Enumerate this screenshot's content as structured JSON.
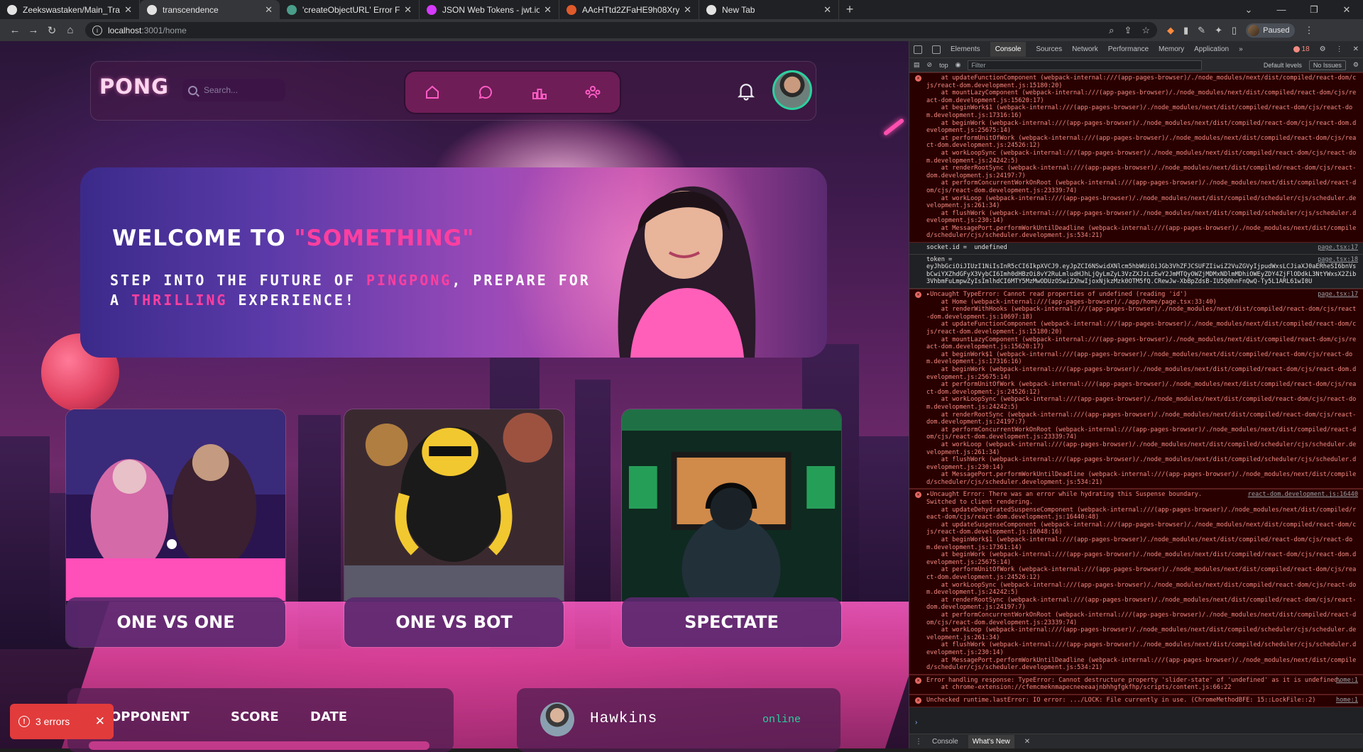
{
  "browser": {
    "tabs": [
      {
        "title": "Zeekswastaken/Main_Tra",
        "fav": "#e3e3e3",
        "active": false
      },
      {
        "title": "transcendence",
        "fav": "#e3e3e3",
        "active": true
      },
      {
        "title": "'createObjectURL' Error F",
        "fav": "#4a9d8a",
        "active": false
      },
      {
        "title": "JSON Web Tokens - jwt.io",
        "fav": "#d63aff",
        "active": false
      },
      {
        "title": "AAcHTtd2ZFaHE9h08Xry",
        "fav": "#e05a2b",
        "active": false
      },
      {
        "title": "New Tab",
        "fav": "#e3e3e3",
        "active": false
      }
    ],
    "url_host": "localhost",
    "url_path": ":3001/home",
    "profile_status": "Paused"
  },
  "page": {
    "logo": "PONG",
    "search_placeholder": "Search...",
    "hero": {
      "title_main": "WELCOME TO ",
      "title_highlight": "\"SOMETHING\"",
      "sub_a": "STEP INTO THE FUTURE OF ",
      "sub_hl1": "PINGPONG",
      "sub_b": ", PREPARE FOR A ",
      "sub_hl2": "THRILLING",
      "sub_c": " EXPERIENCE!"
    },
    "modes": [
      "ONE VS ONE",
      "ONE VS BOT",
      "SPECTATE"
    ],
    "history_cols": [
      "OPPONENT",
      "SCORE",
      "DATE"
    ],
    "friend": {
      "name": "Hawkins",
      "status": "online"
    },
    "error_toast": "3 errors"
  },
  "devtools": {
    "tabs": [
      "Elements",
      "Console",
      "Sources",
      "Network",
      "Performance",
      "Memory",
      "Application"
    ],
    "active_tab": "Console",
    "error_count": "18",
    "context": "top",
    "filter_placeholder": "Filter",
    "levels": "Default levels",
    "issues": "No Issues",
    "drawer_tabs": [
      "Console",
      "What's New"
    ],
    "messages": [
      {
        "type": "err",
        "src": "",
        "text": "    at updateFunctionComponent (webpack-internal:///(app-pages-browser)/./node_modules/next/dist/compiled/react-dom/cjs/react-dom.development.js:15180:20)\n    at mountLazyComponent (webpack-internal:///(app-pages-browser)/./node_modules/next/dist/compiled/react-dom/cjs/react-dom.development.js:15620:17)\n    at beginWork$1 (webpack-internal:///(app-pages-browser)/./node_modules/next/dist/compiled/react-dom/cjs/react-dom.development.js:17316:16)\n    at beginWork (webpack-internal:///(app-pages-browser)/./node_modules/next/dist/compiled/react-dom/cjs/react-dom.development.js:25675:14)\n    at performUnitOfWork (webpack-internal:///(app-pages-browser)/./node_modules/next/dist/compiled/react-dom/cjs/react-dom.development.js:24526:12)\n    at workLoopSync (webpack-internal:///(app-pages-browser)/./node_modules/next/dist/compiled/react-dom/cjs/react-dom.development.js:24242:5)\n    at renderRootSync (webpack-internal:///(app-pages-browser)/./node_modules/next/dist/compiled/react-dom/cjs/react-dom.development.js:24197:7)\n    at performConcurrentWorkOnRoot (webpack-internal:///(app-pages-browser)/./node_modules/next/dist/compiled/react-dom/cjs/react-dom.development.js:23339:74)\n    at workLoop (webpack-internal:///(app-pages-browser)/./node_modules/next/dist/compiled/scheduler/cjs/scheduler.development.js:261:34)\n    at flushWork (webpack-internal:///(app-pages-browser)/./node_modules/next/dist/compiled/scheduler/cjs/scheduler.development.js:230:14)\n    at MessagePort.performWorkUntilDeadline (webpack-internal:///(app-pages-browser)/./node_modules/next/dist/compiled/scheduler/cjs/scheduler.development.js:534:21)"
      },
      {
        "type": "log",
        "src": "page.tsx:17",
        "text": "socket.id =  undefined"
      },
      {
        "type": "log",
        "src": "page.tsx:18",
        "text": "token =\neyJhbGciOiJIUzI1NiIsInR5cCI6IkpXVCJ9.eyJpZCI6NSwidXNlcm5hbWUiOiJGb3VhZFJCSUFZIiwiZ2VuZGVyIjpudWxsLCJiaXJ0aERheSI6bnVsbCwiYXZhdGFyX3VybCI6Imh0dHBzOi8vY2RuLmludHJhLjQyLmZyL3VzZXJzLzEwY2JmMTQyOWZjMDMxNDlmMDhiOWEyZDY4ZjFlODdkL3NtYWxsX2Zib3VhbmFuLmpwZyIsImlhdCI6MTY5MzMwODUzOSwiZXhwIjoxNjkzMzk0OTM5fQ.CRewJw-XbBpZdsB-IU5Q0hnFnQwQ-Ty5L1ARL61wI0U"
      },
      {
        "type": "err",
        "src": "page.tsx:17",
        "text": "▸Uncaught TypeError: Cannot read properties of undefined (reading 'id')\n    at Home (webpack-internal:///(app-pages-browser)/./app/home/page.tsx:33:40)\n    at renderWithHooks (webpack-internal:///(app-pages-browser)/./node_modules/next/dist/compiled/react-dom/cjs/react-dom.development.js:10697:18)\n    at updateFunctionComponent (webpack-internal:///(app-pages-browser)/./node_modules/next/dist/compiled/react-dom/cjs/react-dom.development.js:15180:20)\n    at mountLazyComponent (webpack-internal:///(app-pages-browser)/./node_modules/next/dist/compiled/react-dom/cjs/react-dom.development.js:15620:17)\n    at beginWork$1 (webpack-internal:///(app-pages-browser)/./node_modules/next/dist/compiled/react-dom/cjs/react-dom.development.js:17316:16)\n    at beginWork (webpack-internal:///(app-pages-browser)/./node_modules/next/dist/compiled/react-dom/cjs/react-dom.development.js:25675:14)\n    at performUnitOfWork (webpack-internal:///(app-pages-browser)/./node_modules/next/dist/compiled/react-dom/cjs/react-dom.development.js:24526:12)\n    at workLoopSync (webpack-internal:///(app-pages-browser)/./node_modules/next/dist/compiled/react-dom/cjs/react-dom.development.js:24242:5)\n    at renderRootSync (webpack-internal:///(app-pages-browser)/./node_modules/next/dist/compiled/react-dom/cjs/react-dom.development.js:24197:7)\n    at performConcurrentWorkOnRoot (webpack-internal:///(app-pages-browser)/./node_modules/next/dist/compiled/react-dom/cjs/react-dom.development.js:23339:74)\n    at workLoop (webpack-internal:///(app-pages-browser)/./node_modules/next/dist/compiled/scheduler/cjs/scheduler.development.js:261:34)\n    at flushWork (webpack-internal:///(app-pages-browser)/./node_modules/next/dist/compiled/scheduler/cjs/scheduler.development.js:230:14)\n    at MessagePort.performWorkUntilDeadline (webpack-internal:///(app-pages-browser)/./node_modules/next/dist/compiled/scheduler/cjs/scheduler.development.js:534:21)"
      },
      {
        "type": "err",
        "src": "react-dom.development.js:16440",
        "text": "▸Uncaught Error: There was an error while hydrating this Suspense boundary.\nSwitched to client rendering.\n    at updateDehydratedSuspenseComponent (webpack-internal:///(app-pages-browser)/./node_modules/next/dist/compiled/react-dom/cjs/react-dom.development.js:16440:48)\n    at updateSuspenseComponent (webpack-internal:///(app-pages-browser)/./node_modules/next/dist/compiled/react-dom/cjs/react-dom.development.js:16048:16)\n    at beginWork$1 (webpack-internal:///(app-pages-browser)/./node_modules/next/dist/compiled/react-dom/cjs/react-dom.development.js:17361:14)\n    at beginWork (webpack-internal:///(app-pages-browser)/./node_modules/next/dist/compiled/react-dom/cjs/react-dom.development.js:25675:14)\n    at performUnitOfWork (webpack-internal:///(app-pages-browser)/./node_modules/next/dist/compiled/react-dom/cjs/react-dom.development.js:24526:12)\n    at workLoopSync (webpack-internal:///(app-pages-browser)/./node_modules/next/dist/compiled/react-dom/cjs/react-dom.development.js:24242:5)\n    at renderRootSync (webpack-internal:///(app-pages-browser)/./node_modules/next/dist/compiled/react-dom/cjs/react-dom.development.js:24197:7)\n    at performConcurrentWorkOnRoot (webpack-internal:///(app-pages-browser)/./node_modules/next/dist/compiled/react-dom/cjs/react-dom.development.js:23339:74)\n    at workLoop (webpack-internal:///(app-pages-browser)/./node_modules/next/dist/compiled/scheduler/cjs/scheduler.development.js:261:34)\n    at flushWork (webpack-internal:///(app-pages-browser)/./node_modules/next/dist/compiled/scheduler/cjs/scheduler.development.js:230:14)\n    at MessagePort.performWorkUntilDeadline (webpack-internal:///(app-pages-browser)/./node_modules/next/dist/compiled/scheduler/cjs/scheduler.development.js:534:21)"
      },
      {
        "type": "err",
        "src": "home:1",
        "text": "Error handling response: TypeError: Cannot destructure property 'slider-state' of 'undefined' as it is undefined.\n    at chrome-extension://cfemcmeknmapecneeeaajnbhhgfgkfhp/scripts/content.js:66:22"
      },
      {
        "type": "err",
        "src": "home:1",
        "text": "Unchecked runtime.lastError: IO error: .../LOCK: File currently in use. (ChromeMethodBFE: 15::LockFile::2)"
      }
    ]
  }
}
